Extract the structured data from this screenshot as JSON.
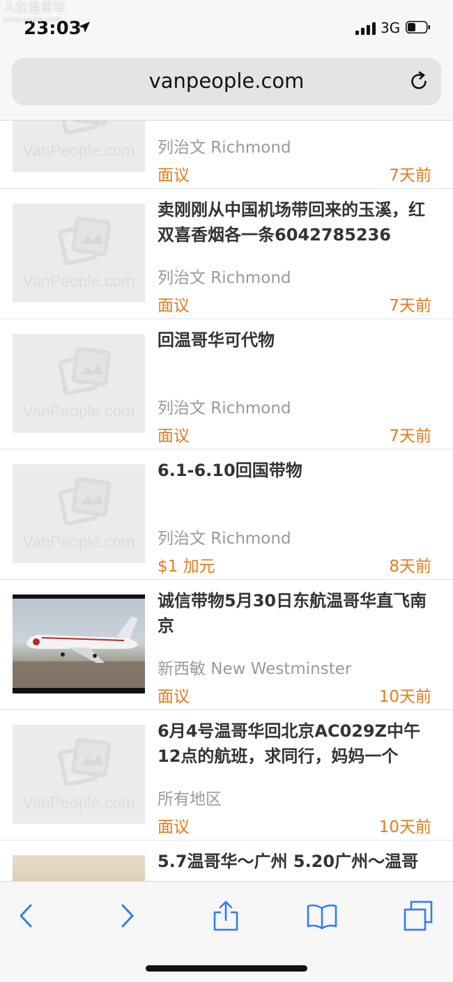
{
  "watermark": {
    "text": "人在温哥华",
    "sub": "vanpeople.com"
  },
  "status": {
    "time": "23:03",
    "network": "3G"
  },
  "browser": {
    "url": "vanpeople.com"
  },
  "placeholder_logo_text": "VanPeople.com",
  "listings": [
    {
      "title": "",
      "location": "列治文 Richmond",
      "price": "面议",
      "age": "7天前",
      "thumb": "placeholder"
    },
    {
      "title": "卖刚刚从中国机场带回来的玉溪，红双喜香烟各一条6042785236",
      "location": "列治文 Richmond",
      "price": "面议",
      "age": "7天前",
      "thumb": "placeholder"
    },
    {
      "title": "回温哥华可代物",
      "location": "列治文 Richmond",
      "price": "面议",
      "age": "7天前",
      "thumb": "placeholder"
    },
    {
      "title": "6.1-6.10回国带物",
      "location": "列治文 Richmond",
      "price": "$1 加元",
      "age": "8天前",
      "thumb": "placeholder"
    },
    {
      "title": "诚信带物5月30日东航温哥华直飞南京",
      "location": "新西敏 New Westminster",
      "price": "面议",
      "age": "10天前",
      "thumb": "airplane-photo"
    },
    {
      "title": "6月4号温哥华回北京AC029Z中午12点的航班，求同行，妈妈一个",
      "location": "所有地区",
      "price": "面议",
      "age": "10天前",
      "thumb": "placeholder"
    },
    {
      "title": "5.7温哥华～广州 5.20广州～温哥",
      "location": "",
      "price": "",
      "age": "",
      "thumb": "room-photo"
    }
  ],
  "colors": {
    "accent": "#e27d1d",
    "ios_blue": "#2f7cf6",
    "muted": "#9a9a9a"
  }
}
